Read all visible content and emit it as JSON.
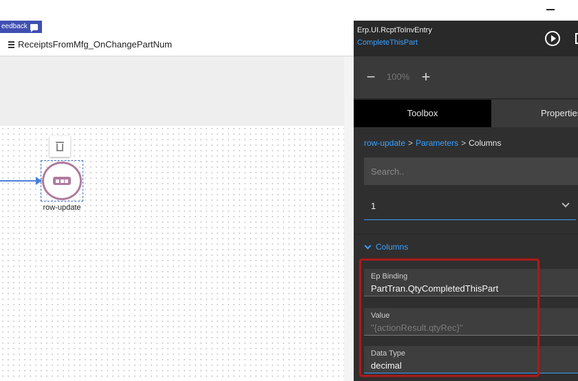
{
  "feedback": {
    "label": "eedback"
  },
  "workflow": {
    "title": "ReceiptsFromMfg_OnChangePartNum"
  },
  "canvas": {
    "node_label": "row-update"
  },
  "panel": {
    "title": "Erp.UI.RcptToInvEntry",
    "subtitle": "CompleteThisPart",
    "zoom": {
      "minus": "−",
      "value": "100%",
      "plus": "+"
    },
    "tabs": {
      "toolbox": "Toolbox",
      "properties": "Properties"
    },
    "breadcrumb": {
      "item1": "row-update",
      "sep": ">",
      "item2": "Parameters",
      "item3": "Columns"
    },
    "search": {
      "placeholder": "Search.."
    },
    "select": {
      "value": "1"
    },
    "section": {
      "label": "Columns"
    },
    "fields": {
      "ep_binding": {
        "label": "Ep Binding",
        "value": "PartTran.QtyCompletedThisPart"
      },
      "value": {
        "label": "Value",
        "value": "\"{actionResult.qtyRec}\""
      },
      "data_type": {
        "label": "Data Type",
        "value": "decimal"
      }
    }
  },
  "colors": {
    "accent": "#3aa0ff",
    "node": "#b07a9e",
    "connector": "#4a7fd8",
    "highlight": "#a81c1c"
  }
}
